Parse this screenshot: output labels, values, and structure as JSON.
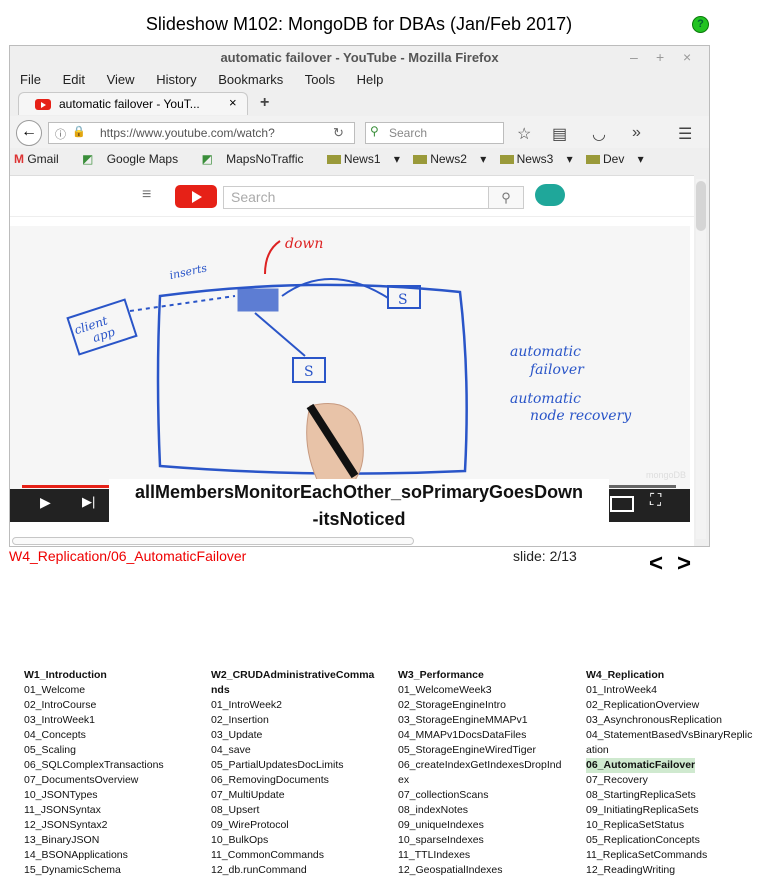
{
  "page": {
    "title": "Slideshow M102: MongoDB for DBAs (Jan/Feb 2017)",
    "help_glyph": "?"
  },
  "browser": {
    "window_title": "automatic failover - YouTube - Mozilla Firefox",
    "window_controls": [
      "–",
      "+",
      "×"
    ],
    "menu": [
      "File",
      "Edit",
      "View",
      "History",
      "Bookmarks",
      "Tools",
      "Help"
    ],
    "tab": {
      "label": "automatic failover - YouT...",
      "close": "×"
    },
    "new_tab": "+",
    "url": "https://www.youtube.com/watch?",
    "search_placeholder": "Search",
    "bookmarks": [
      "Gmail",
      "Google Maps",
      "MapsNoTraffic",
      "News1",
      "News2",
      "News3",
      "Dev"
    ]
  },
  "youtube": {
    "search_placeholder": "Search",
    "watermark": "mongoDB"
  },
  "video": {
    "progress": 0.14
  },
  "whiteboard": {
    "down": "down",
    "client": "client",
    "app": "app",
    "inserts": "inserts",
    "s": "S",
    "bullet1a": "automatic",
    "bullet1b": "failover",
    "bullet2a": "automatic",
    "bullet2b": "node recovery"
  },
  "caption": {
    "line1": "allMembersMonitorEachOther_soPrimaryGoesDown",
    "line2": "-itsNoticed"
  },
  "nav": {
    "breadcrumb": "W4_Replication/06_AutomaticFailover",
    "slide": "slide: 2/13",
    "prev": "<",
    "next": ">"
  },
  "index": [
    {
      "head": "W1_Introduction",
      "items": [
        "01_Welcome",
        "02_IntroCourse",
        "03_IntroWeek1",
        "04_Concepts",
        "05_Scaling",
        "06_SQLComplexTransactions",
        "07_DocumentsOverview",
        "10_JSONTypes",
        "11_JSONSyntax",
        "12_JSONSyntax2",
        "13_BinaryJSON",
        "14_BSONApplications",
        "15_DynamicSchema"
      ]
    },
    {
      "head": "W2_CRUDAdministrativeComma",
      "head2": "nds",
      "items": [
        "01_IntroWeek2",
        "02_Insertion",
        "03_Update",
        "04_save",
        "05_PartialUpdatesDocLimits",
        "06_RemovingDocuments",
        "07_MultiUpdate",
        "08_Upsert",
        "09_WireProtocol",
        "10_BulkOps",
        "11_CommonCommands",
        "12_db.runCommand"
      ]
    },
    {
      "head": "W3_Performance",
      "items": [
        "01_WelcomeWeek3",
        "02_StorageEngineIntro",
        "03_StorageEngineMMAPv1",
        "04_MMAPv1DocsDataFiles",
        "05_StorageEngineWiredTiger",
        "06_createIndexGetIndexesDropInd",
        "ex",
        "07_collectionScans",
        "08_indexNotes",
        "09_uniqueIndexes",
        "10_sparseIndexes",
        "11_TTLIndexes",
        "12_GeospatialIndexes"
      ]
    },
    {
      "head": "W4_Replication",
      "items": [
        "01_IntroWeek4",
        "02_ReplicationOverview",
        "03_AsynchronousReplication",
        "04_StatementBasedVsBinaryReplic",
        "ation",
        "06_AutomaticFailover",
        "07_Recovery",
        "08_StartingReplicaSets",
        "09_InitiatingReplicaSets",
        "10_ReplicaSetStatus",
        "11_ReplicaSetCommands",
        "12_ReadingWriting"
      ],
      "highlight": 5
    }
  ],
  "index_item_05": "05_ReplicationConcepts"
}
